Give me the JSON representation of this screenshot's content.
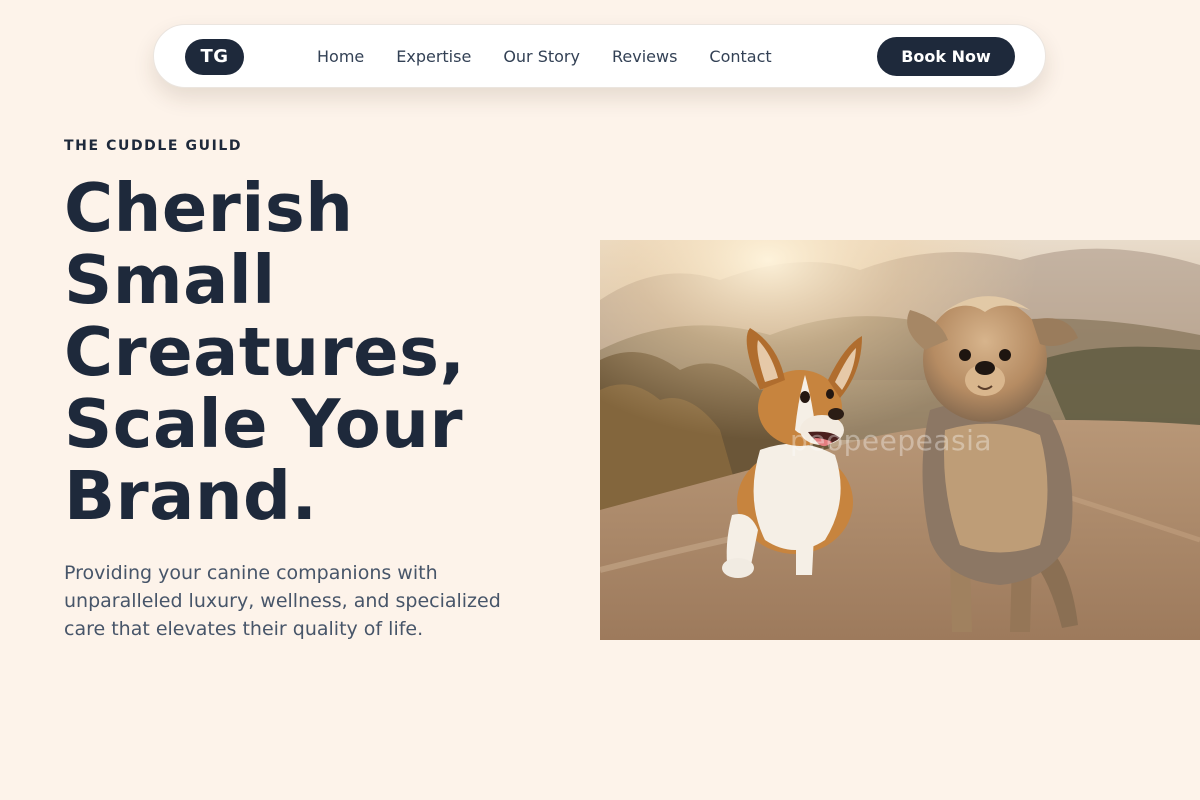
{
  "nav": {
    "logo": "TG",
    "links": [
      {
        "label": "Home"
      },
      {
        "label": "Expertise"
      },
      {
        "label": "Our Story"
      },
      {
        "label": "Reviews"
      },
      {
        "label": "Contact"
      }
    ],
    "cta_label": "Book Now"
  },
  "hero": {
    "eyebrow": "THE CUDDLE GUILD",
    "headline_lines": [
      "Cherish",
      "Small",
      "Creatures,",
      "Scale Your",
      "Brand."
    ],
    "subtext": "Providing your canine companions with unparalleled luxury, wellness, and specialized care that elevates their quality of life."
  },
  "photo": {
    "subject": "two dogs running on a dirt path at sunset",
    "watermark": "peopeepeasia"
  },
  "colors": {
    "background": "#fdf3ea",
    "primary": "#1e293b",
    "body_text": "#475569",
    "nav_text": "#334155"
  }
}
